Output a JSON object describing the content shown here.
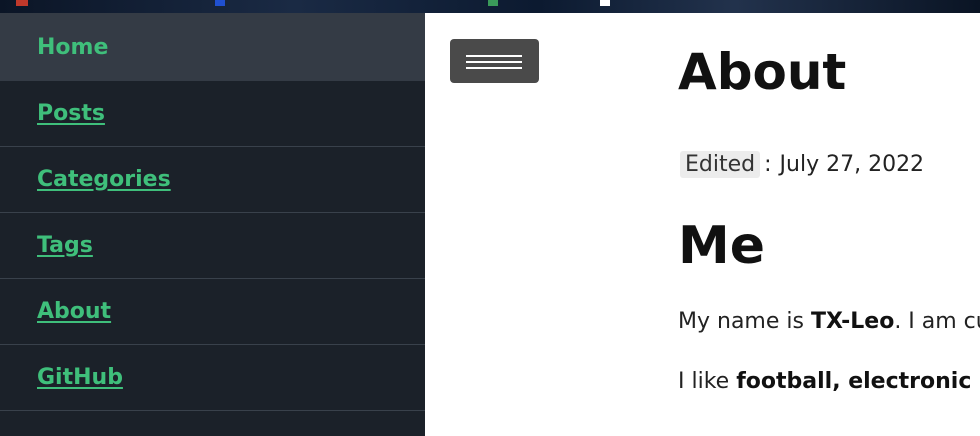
{
  "sidebar": {
    "items": [
      {
        "label": "Home",
        "active": true
      },
      {
        "label": "Posts"
      },
      {
        "label": "Categories"
      },
      {
        "label": "Tags"
      },
      {
        "label": "About"
      },
      {
        "label": "GitHub"
      }
    ]
  },
  "menu_button": {
    "icon": "hamburger-icon"
  },
  "main": {
    "title": "About",
    "meta": {
      "label": "Edited",
      "separator": ":",
      "date": "July 27, 2022"
    },
    "section_title": "Me",
    "paragraph1": {
      "prefix": "My name is ",
      "bold": "TX-Leo",
      "suffix": ". I am curre"
    },
    "paragraph2": {
      "prefix": "I like ",
      "bold": "football, electronic prod"
    }
  },
  "colors": {
    "sidebar_bg": "#1b2129",
    "sidebar_active_bg": "#343b45",
    "link": "#3fbf7b",
    "menu_button_bg": "#4a4a4a"
  }
}
